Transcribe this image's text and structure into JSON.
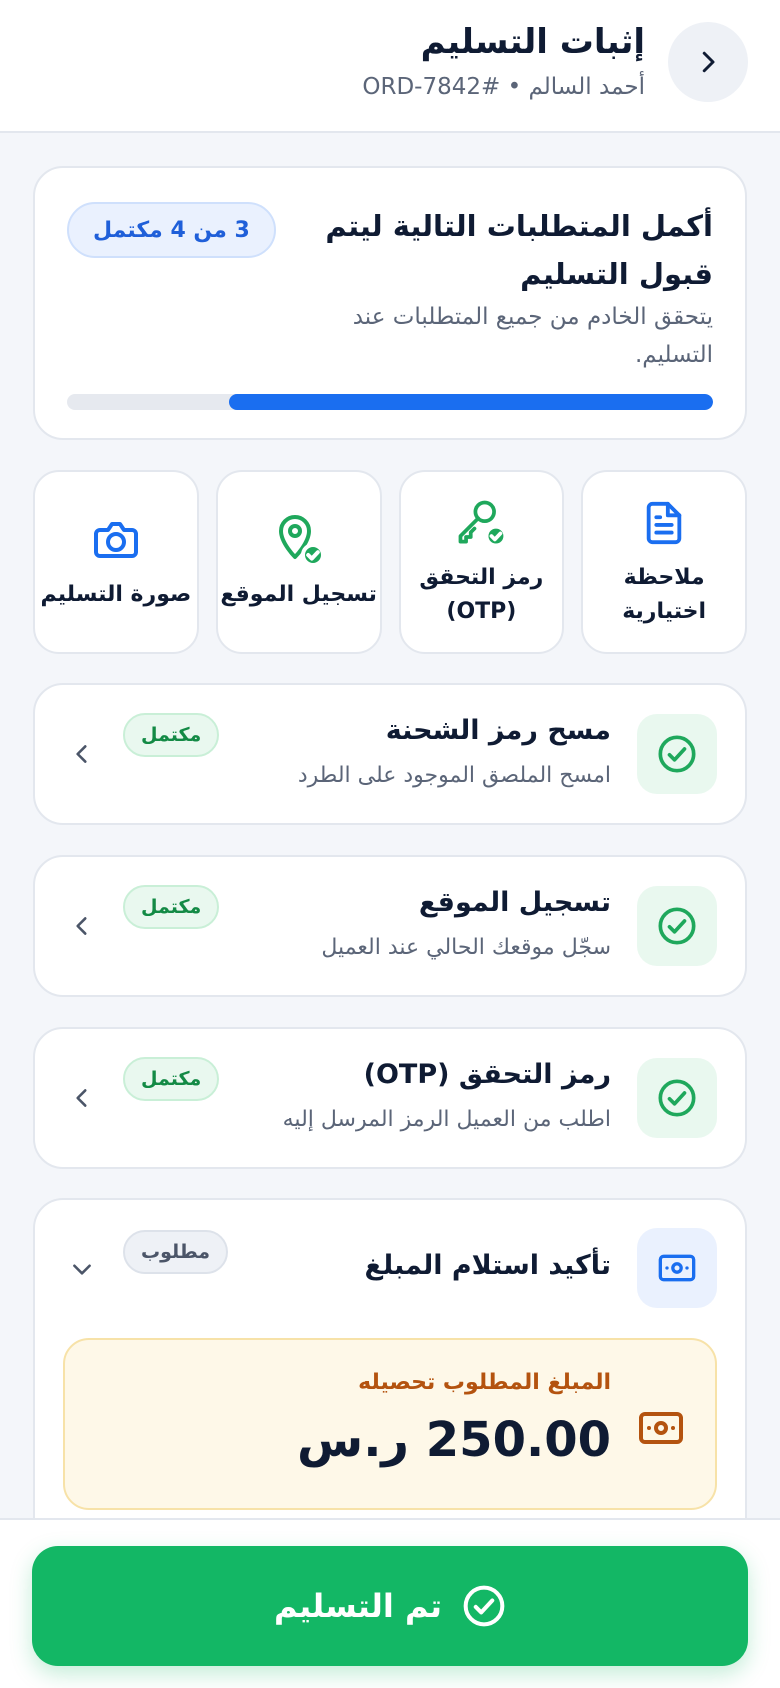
{
  "header": {
    "title": "إثبات التسليم",
    "subtitle": "أحمد السالم • #ORD-7842"
  },
  "progress": {
    "title": "أكمل المتطلبات التالية ليتم قبول التسليم",
    "description": "يتحقق الخادم من جميع المتطلبات عند التسليم.",
    "badge": "3 من 4 مكتمل",
    "fraction": 0.75
  },
  "tiles": [
    {
      "label": "ملاحظة\nاختيارية",
      "icon": "document-icon"
    },
    {
      "label": "رمز التحقق\n(OTP)",
      "icon": "key-check-icon"
    },
    {
      "label": "تسجيل الموقع",
      "icon": "location-check-icon"
    },
    {
      "label": "صورة التسليم",
      "icon": "camera-icon"
    }
  ],
  "steps": [
    {
      "title": "مسح رمز الشحنة",
      "description": "امسح الملصق الموجود على الطرد",
      "status": "مكتمل"
    },
    {
      "title": "تسجيل الموقع",
      "description": "سجّل موقعك الحالي عند العميل",
      "status": "مكتمل"
    },
    {
      "title": "رمز التحقق (OTP)",
      "description": "اطلب من العميل الرمز المرسل إليه",
      "status": "مكتمل"
    }
  ],
  "payment": {
    "title": "تأكيد استلام المبلغ",
    "status": "مطلوب",
    "amount_label": "المبلغ المطلوب تحصيله",
    "amount_value": "250.00 ر.س"
  },
  "footer": {
    "confirm_label": "تم التسليم"
  },
  "colors": {
    "primary_blue": "#1a6ef0",
    "success_green": "#13b765",
    "complete_badge": "#138a45",
    "amount_orange": "#b4530f"
  }
}
